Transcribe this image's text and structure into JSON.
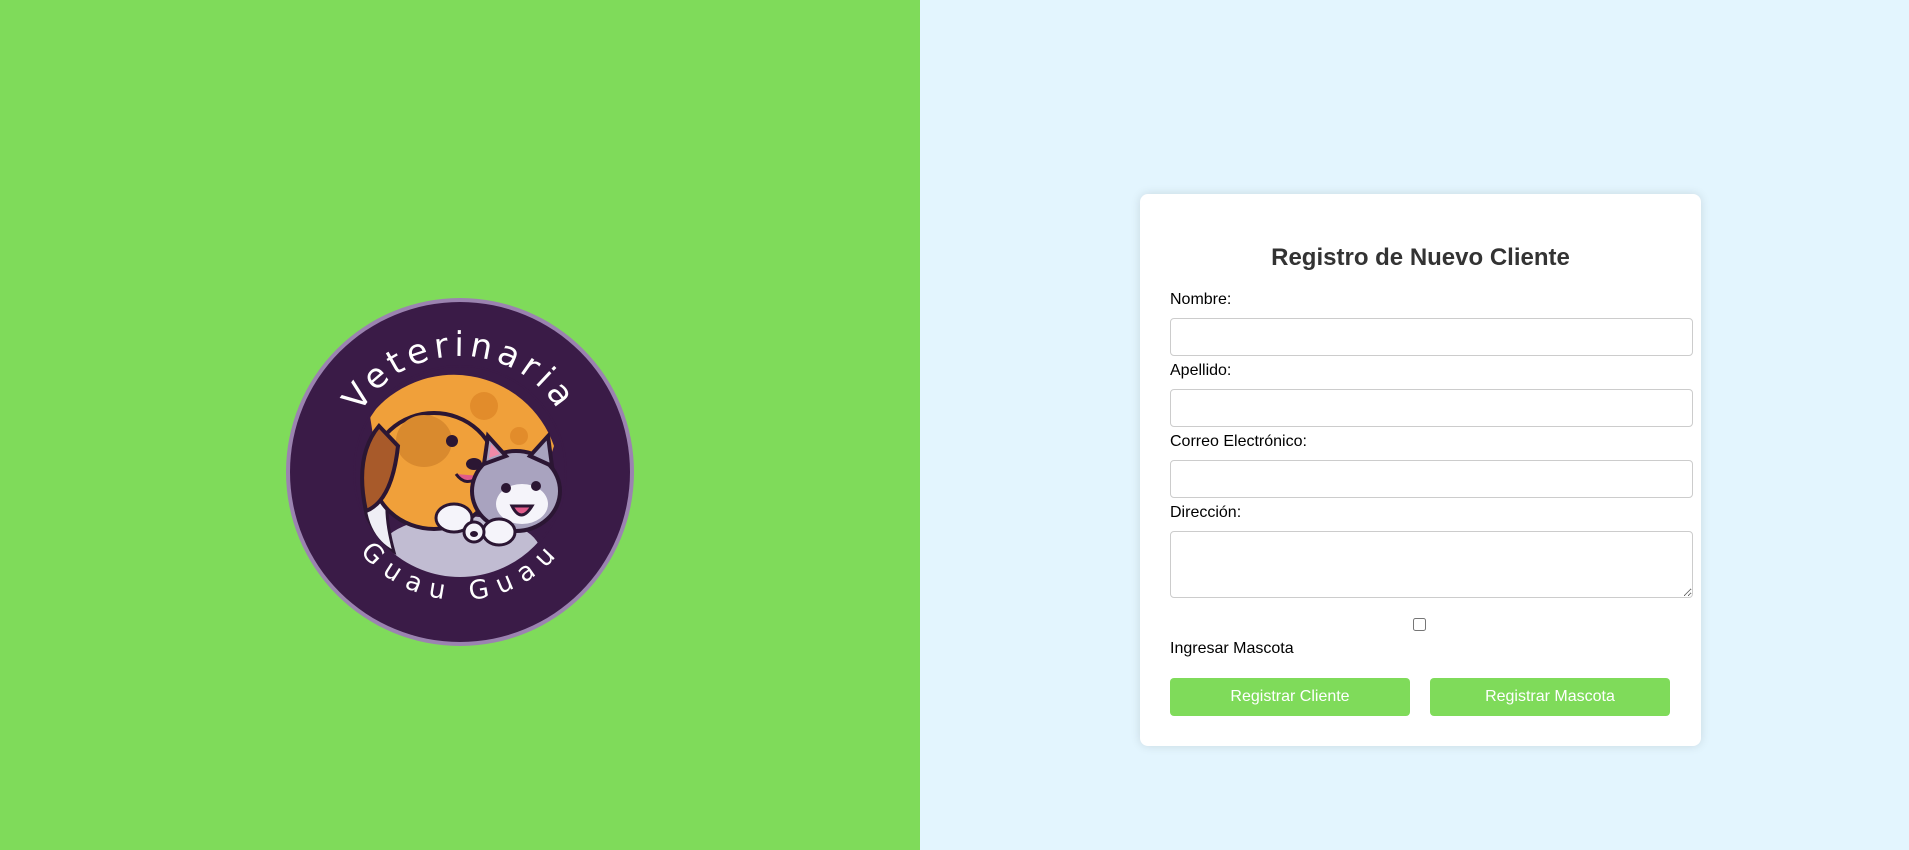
{
  "colors": {
    "left_background": "#7fdb5a",
    "right_background": "#e3f5fe",
    "button": "#7fdb5a",
    "logo_ring": "#3a1b47",
    "logo_border": "#9b83b0"
  },
  "logo": {
    "top_text": "Veterinaria",
    "bottom_text": "Guau Guau"
  },
  "form": {
    "title": "Registro de Nuevo Cliente",
    "nombre_label": "Nombre:",
    "nombre_value": "",
    "apellido_label": "Apellido:",
    "apellido_value": "",
    "correo_label": "Correo Electrónico:",
    "correo_value": "",
    "direccion_label": "Dirección:",
    "direccion_value": "",
    "checkbox_label": "Ingresar Mascota",
    "register_client_label": "Registrar Cliente",
    "register_pet_label": "Registrar Mascota"
  }
}
